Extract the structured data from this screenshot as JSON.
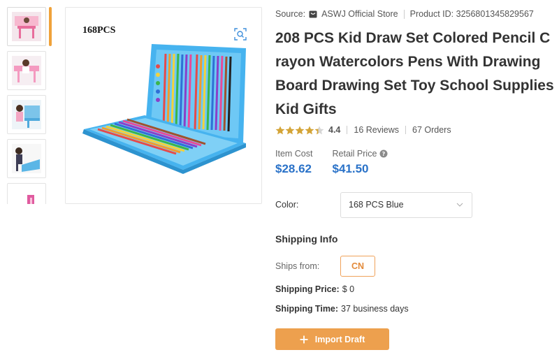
{
  "gallery": {
    "main_image_label": "168PCS",
    "thumbnails": [
      "thumb-1",
      "thumb-2",
      "thumb-3",
      "thumb-4",
      "thumb-5"
    ]
  },
  "product": {
    "source_label": "Source:",
    "store_name": "ASWJ Official Store",
    "product_id_label": "Product ID: 3256801345829567",
    "title": "208 PCS Kid Draw Set Colored Pencil Crayon Watercolors Pens With Drawing Board Drawing Set Toy School Supplies Kid Gifts",
    "rating": "4.4",
    "rating_fraction": 0.88,
    "reviews": "16 Reviews",
    "orders": "67 Orders"
  },
  "pricing": {
    "item_cost_label": "Item Cost",
    "item_cost": "$28.62",
    "retail_price_label": "Retail Price",
    "retail_price": "$41.50"
  },
  "options": {
    "color_label": "Color:",
    "color_value": "168 PCS Blue"
  },
  "shipping": {
    "title": "Shipping Info",
    "ships_from_label": "Ships from:",
    "ships_from_value": "CN",
    "price_label": "Shipping Price:",
    "price_value": "$ 0",
    "time_label": "Shipping Time:",
    "time_value": "37 business days"
  },
  "actions": {
    "import_label": "Import Draft"
  },
  "colors": {
    "accent_orange": "#eda04e",
    "price_blue": "#2a72c8",
    "star_gold": "#d4a437"
  }
}
